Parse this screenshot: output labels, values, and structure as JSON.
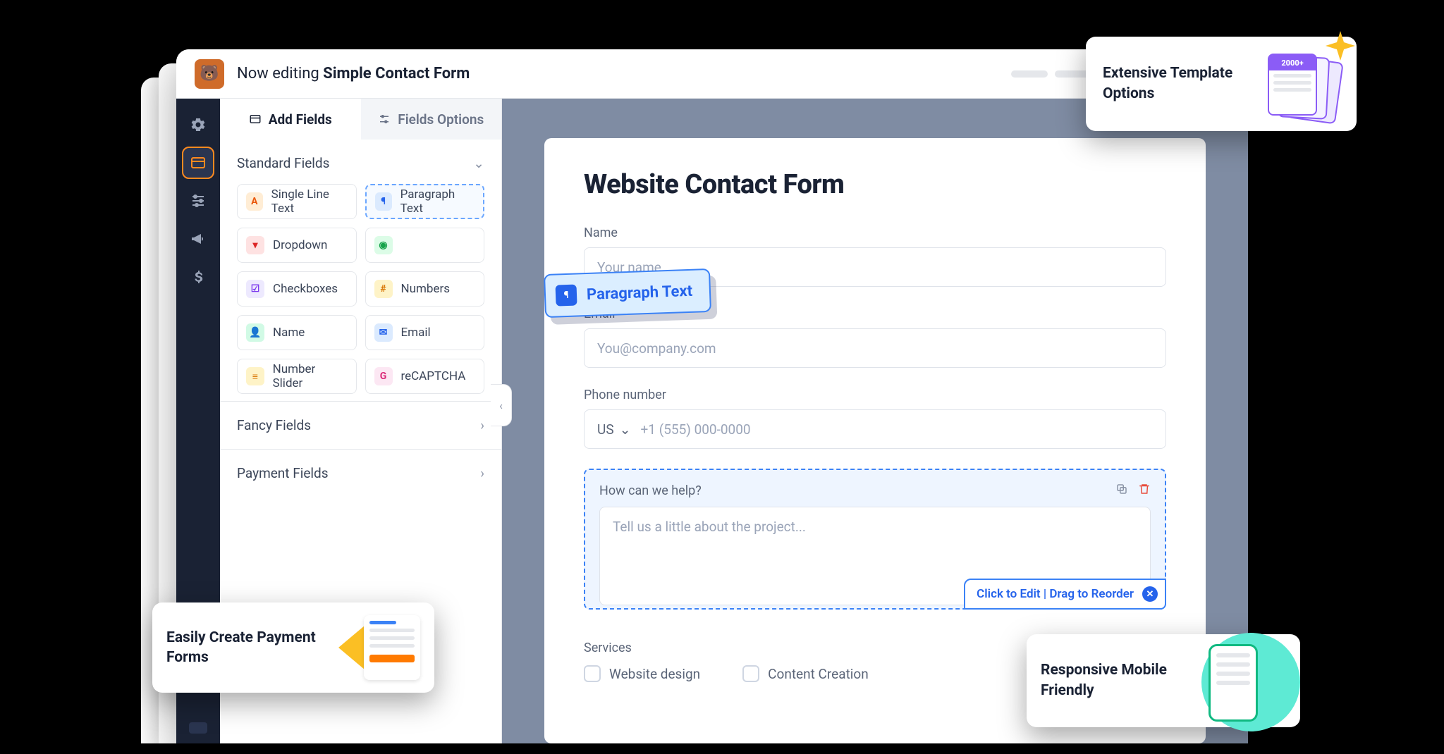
{
  "header": {
    "now_editing_prefix": "Now editing ",
    "form_name": "Simple Contact Form"
  },
  "tabs": {
    "add_fields": "Add Fields",
    "field_options": "Fields Options"
  },
  "sidebar": {
    "standard_heading": "Standard Fields",
    "fields": {
      "single_line": "Single Line Text",
      "paragraph": "Paragraph Text",
      "dropdown": "Dropdown",
      "checkboxes": "Checkboxes",
      "numbers": "Numbers",
      "name": "Name",
      "email": "Email",
      "number_slider": "Number Slider",
      "recaptcha": "reCAPTCHA"
    },
    "fancy": "Fancy Fields",
    "payment": "Payment Fields"
  },
  "drag_chip": "Paragraph Text",
  "form": {
    "title": "Website Contact Form",
    "name_label": "Name",
    "name_placeholder": "Your name",
    "email_label": "Email",
    "email_placeholder": "You@company.com",
    "phone_label": "Phone number",
    "phone_cc": "US",
    "phone_placeholder": "+1 (555) 000-0000",
    "help_label": "How can we help?",
    "help_placeholder": "Tell us a little about the project...",
    "hint": "Click to Edit | Drag to Reorder",
    "services_label": "Services",
    "svc1": "Website design",
    "svc2": "Content Creation"
  },
  "callouts": {
    "payment": "Easily Create Payment Forms",
    "templates": "Extensive Template Options",
    "templates_badge": "2000+",
    "mobile": "Responsive Mobile Friendly"
  }
}
